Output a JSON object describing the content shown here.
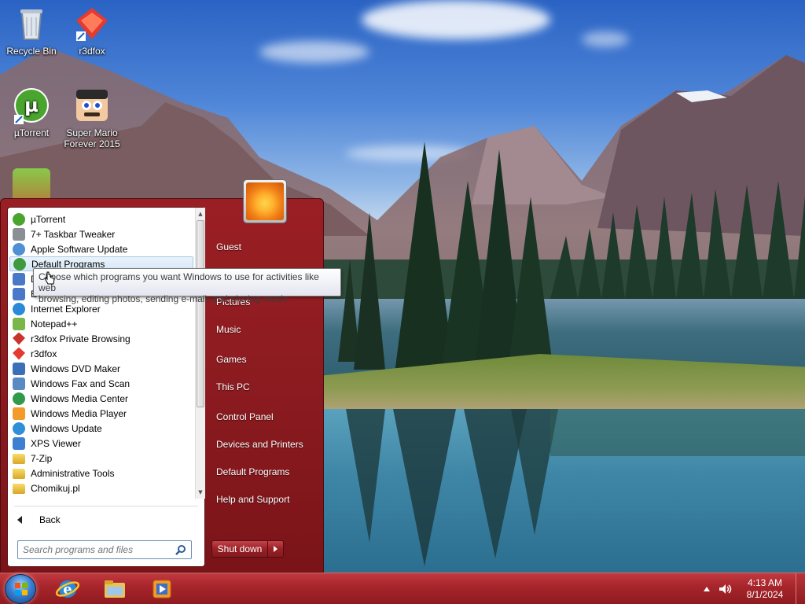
{
  "desktop": {
    "icons": [
      {
        "label": "Recycle Bin"
      },
      {
        "label": "r3dfox"
      },
      {
        "label": "µTorrent"
      },
      {
        "label": "Super Mario Forever 2015"
      }
    ]
  },
  "start_menu": {
    "programs": [
      {
        "label": "µTorrent",
        "icon": "utorrent-icon"
      },
      {
        "label": "7+ Taskbar Tweaker",
        "icon": "tweaker-icon"
      },
      {
        "label": "Apple Software Update",
        "icon": "apple-update-icon"
      },
      {
        "label": "Default Programs",
        "icon": "default-programs-icon"
      },
      {
        "label": "D",
        "icon": "app-icon"
      },
      {
        "label": "E",
        "icon": "app-icon"
      },
      {
        "label": "Internet Explorer",
        "icon": "ie-icon"
      },
      {
        "label": "Notepad++",
        "icon": "notepadpp-icon"
      },
      {
        "label": "r3dfox Private Browsing",
        "icon": "r3dfox-private-icon"
      },
      {
        "label": "r3dfox",
        "icon": "r3dfox-icon"
      },
      {
        "label": "Windows DVD Maker",
        "icon": "dvd-maker-icon"
      },
      {
        "label": "Windows Fax and Scan",
        "icon": "fax-scan-icon"
      },
      {
        "label": "Windows Media Center",
        "icon": "media-center-icon"
      },
      {
        "label": "Windows Media Player",
        "icon": "media-player-icon"
      },
      {
        "label": "Windows Update",
        "icon": "windows-update-icon"
      },
      {
        "label": "XPS Viewer",
        "icon": "xps-viewer-icon"
      },
      {
        "label": "7-Zip",
        "icon": "folder-icon"
      },
      {
        "label": "Administrative Tools",
        "icon": "folder-icon"
      },
      {
        "label": "Chomikuj.pl",
        "icon": "folder-icon"
      }
    ],
    "highlighted_index": 3,
    "back_label": "Back",
    "search_placeholder": "Search programs and files",
    "right_pane": [
      {
        "label": "Guest"
      },
      {
        "label": "Pictures"
      },
      {
        "label": "Music"
      },
      {
        "label": "Games"
      },
      {
        "label": "This PC"
      },
      {
        "label": "Control Panel"
      },
      {
        "label": "Devices and Printers"
      },
      {
        "label": "Default Programs"
      },
      {
        "label": "Help and Support"
      }
    ],
    "shutdown_label": "Shut down",
    "tooltip": {
      "line1": "Choose which programs you want Windows to use for activities like web",
      "line2": "browsing, editing photos, sending e-mail, and playing music."
    }
  },
  "taskbar": {
    "apps": [
      {
        "name": "internet-explorer-icon"
      },
      {
        "name": "file-explorer-icon"
      },
      {
        "name": "media-player-icon"
      }
    ],
    "clock": {
      "time": "4:13 AM",
      "date": "8/1/2024"
    }
  },
  "colors": {
    "accent": "#9a1f24",
    "taskbar": "#a8262c",
    "highlight": "#d6e7f6"
  }
}
